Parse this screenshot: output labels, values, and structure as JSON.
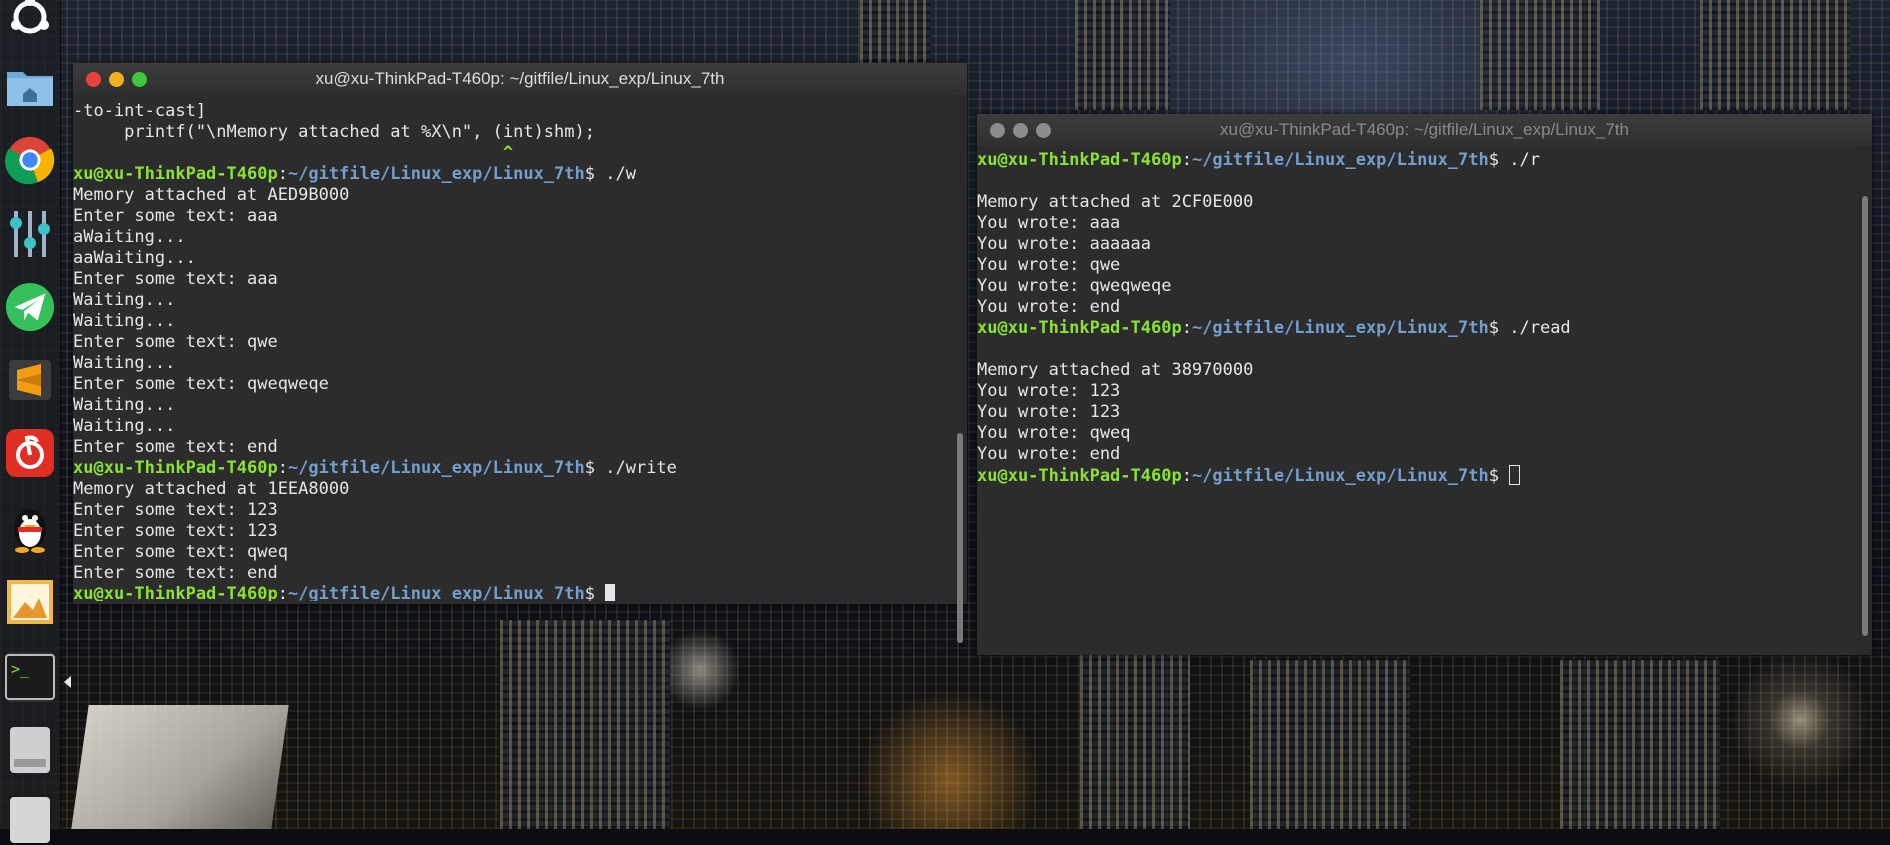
{
  "desktop": {
    "launcher": {
      "items": [
        {
          "name": "ubuntu-logo-icon"
        },
        {
          "name": "home-folder-icon"
        },
        {
          "name": "chrome-icon"
        },
        {
          "name": "mixer-settings-icon"
        },
        {
          "name": "telegram-icon"
        },
        {
          "name": "sublime-text-icon"
        },
        {
          "name": "netease-music-icon"
        },
        {
          "name": "qq-penguin-icon"
        },
        {
          "name": "image-viewer-icon"
        },
        {
          "name": "terminal-icon"
        },
        {
          "name": "drive-icon"
        },
        {
          "name": "drive-icon-2"
        }
      ]
    }
  },
  "left_terminal": {
    "title": "xu@xu-ThinkPad-T460p: ~/gitfile/Linux_exp/Linux_7th",
    "user_host": "xu@xu-ThinkPad-T460p",
    "path": "~/gitfile/Linux_exp/Linux_7th",
    "lines": [
      {
        "type": "text",
        "text": "-to-int-cast]"
      },
      {
        "type": "text",
        "text": "     printf(\"\\nMemory attached at %X\\n\", (int)shm);"
      },
      {
        "type": "caret",
        "text": "                                          ^"
      },
      {
        "type": "prompt",
        "cmd": " ./w"
      },
      {
        "type": "text",
        "text": "Memory attached at AED9B000"
      },
      {
        "type": "text",
        "text": "Enter some text: aaa"
      },
      {
        "type": "text",
        "text": "aWaiting..."
      },
      {
        "type": "text",
        "text": "aaWaiting..."
      },
      {
        "type": "text",
        "text": "Enter some text: aaa"
      },
      {
        "type": "text",
        "text": "Waiting..."
      },
      {
        "type": "text",
        "text": "Waiting..."
      },
      {
        "type": "text",
        "text": "Enter some text: qwe"
      },
      {
        "type": "text",
        "text": "Waiting..."
      },
      {
        "type": "text",
        "text": "Enter some text: qweqweqe"
      },
      {
        "type": "text",
        "text": "Waiting..."
      },
      {
        "type": "text",
        "text": "Waiting..."
      },
      {
        "type": "text",
        "text": "Enter some text: end"
      },
      {
        "type": "prompt",
        "cmd": " ./write"
      },
      {
        "type": "text",
        "text": "Memory attached at 1EEA8000"
      },
      {
        "type": "text",
        "text": "Enter some text: 123"
      },
      {
        "type": "text",
        "text": "Enter some text: 123"
      },
      {
        "type": "text",
        "text": "Enter some text: qweq"
      },
      {
        "type": "text",
        "text": "Enter some text: end"
      },
      {
        "type": "prompt",
        "cmd": " ",
        "cursor": "solid"
      }
    ]
  },
  "right_terminal": {
    "title": "xu@xu-ThinkPad-T460p: ~/gitfile/Linux_exp/Linux_7th",
    "user_host": "xu@xu-ThinkPad-T460p",
    "path": "~/gitfile/Linux_exp/Linux_7th",
    "lines": [
      {
        "type": "prompt",
        "cmd": " ./r"
      },
      {
        "type": "text",
        "text": ""
      },
      {
        "type": "text",
        "text": "Memory attached at 2CF0E000"
      },
      {
        "type": "text",
        "text": "You wrote: aaa"
      },
      {
        "type": "text",
        "text": "You wrote: aaaaaa"
      },
      {
        "type": "text",
        "text": "You wrote: qwe"
      },
      {
        "type": "text",
        "text": "You wrote: qweqweqe"
      },
      {
        "type": "text",
        "text": "You wrote: end"
      },
      {
        "type": "prompt",
        "cmd": " ./read"
      },
      {
        "type": "text",
        "text": ""
      },
      {
        "type": "text",
        "text": "Memory attached at 38970000"
      },
      {
        "type": "text",
        "text": "You wrote: 123"
      },
      {
        "type": "text",
        "text": "You wrote: 123"
      },
      {
        "type": "text",
        "text": "You wrote: qweq"
      },
      {
        "type": "text",
        "text": "You wrote: end"
      },
      {
        "type": "prompt",
        "cmd": " ",
        "cursor": "hollow"
      }
    ]
  },
  "colors": {
    "prompt_user": "#8ae234",
    "prompt_path": "#729fcf",
    "terminal_bg": "#2c2c2c",
    "close": "#e8433f",
    "minimize": "#f2b01e",
    "maximize": "#3ec93c"
  }
}
